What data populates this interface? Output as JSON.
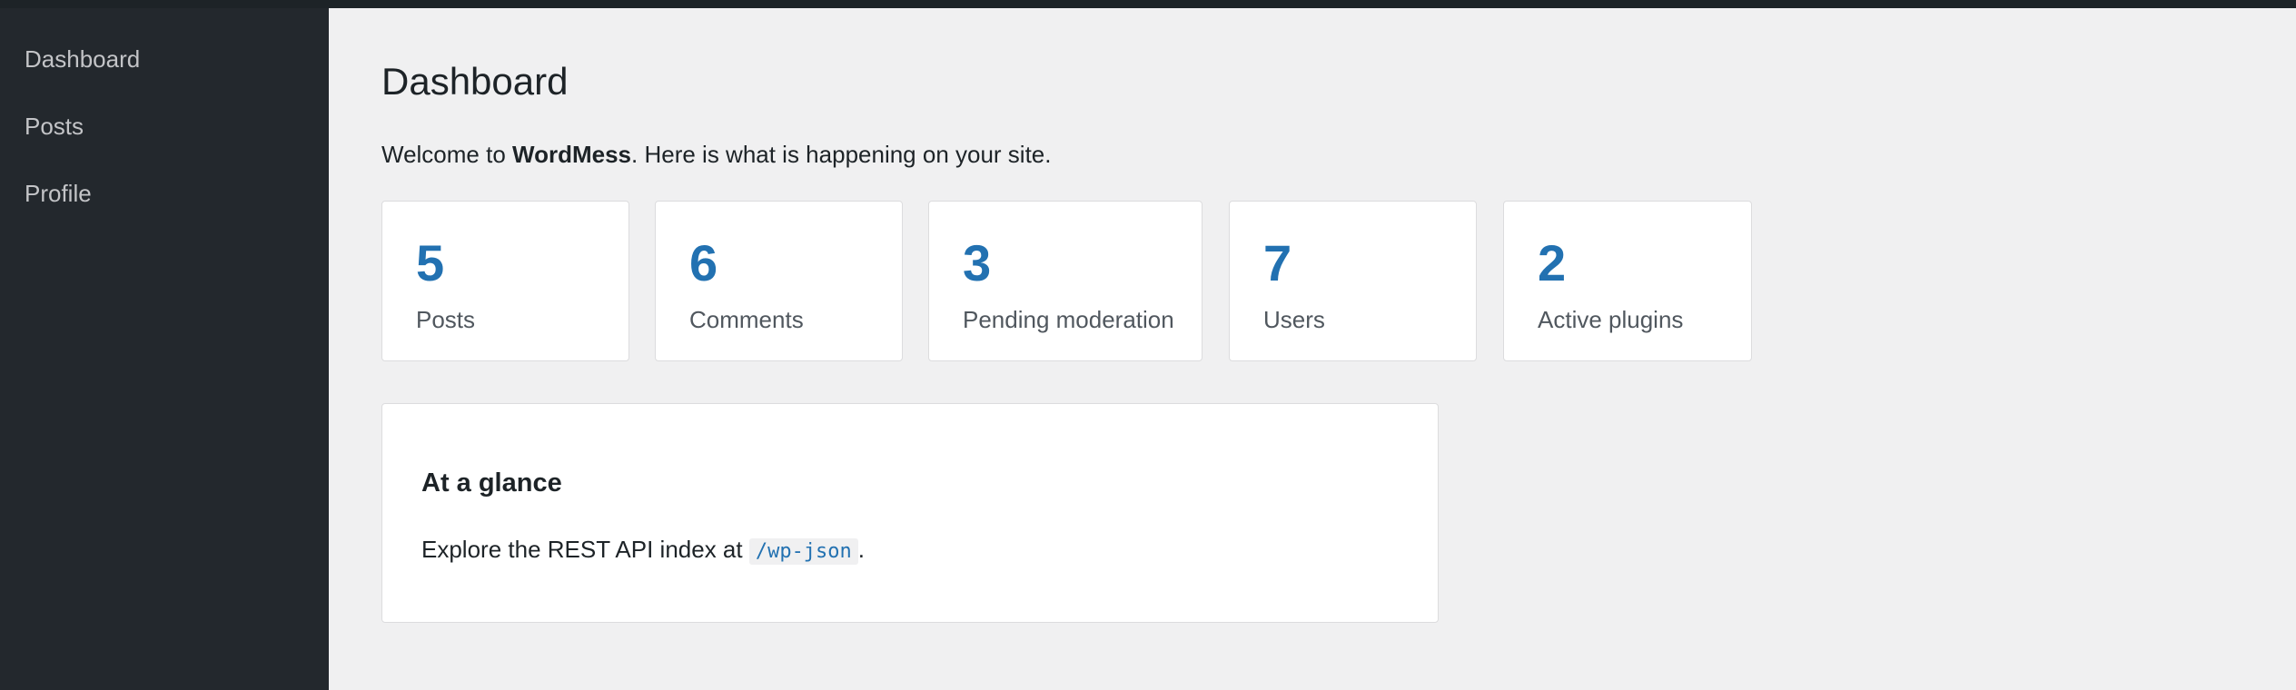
{
  "sidebar": {
    "items": [
      {
        "label": "Dashboard"
      },
      {
        "label": "Posts"
      },
      {
        "label": "Profile"
      }
    ]
  },
  "page": {
    "title": "Dashboard",
    "welcome_prefix": "Welcome to ",
    "site_name": "WordMess",
    "welcome_suffix": ". Here is what is happening on your site."
  },
  "stats": [
    {
      "value": "5",
      "label": "Posts"
    },
    {
      "value": "6",
      "label": "Comments"
    },
    {
      "value": "3",
      "label": "Pending moderation"
    },
    {
      "value": "7",
      "label": "Users"
    },
    {
      "value": "2",
      "label": "Active plugins"
    }
  ],
  "glance": {
    "title": "At a glance",
    "text_prefix": "Explore the REST API index at ",
    "code": "/wp-json",
    "text_suffix": "."
  },
  "colors": {
    "sidebar_bg": "#23282d",
    "accent": "#2271b1",
    "page_bg": "#f0f0f1"
  }
}
